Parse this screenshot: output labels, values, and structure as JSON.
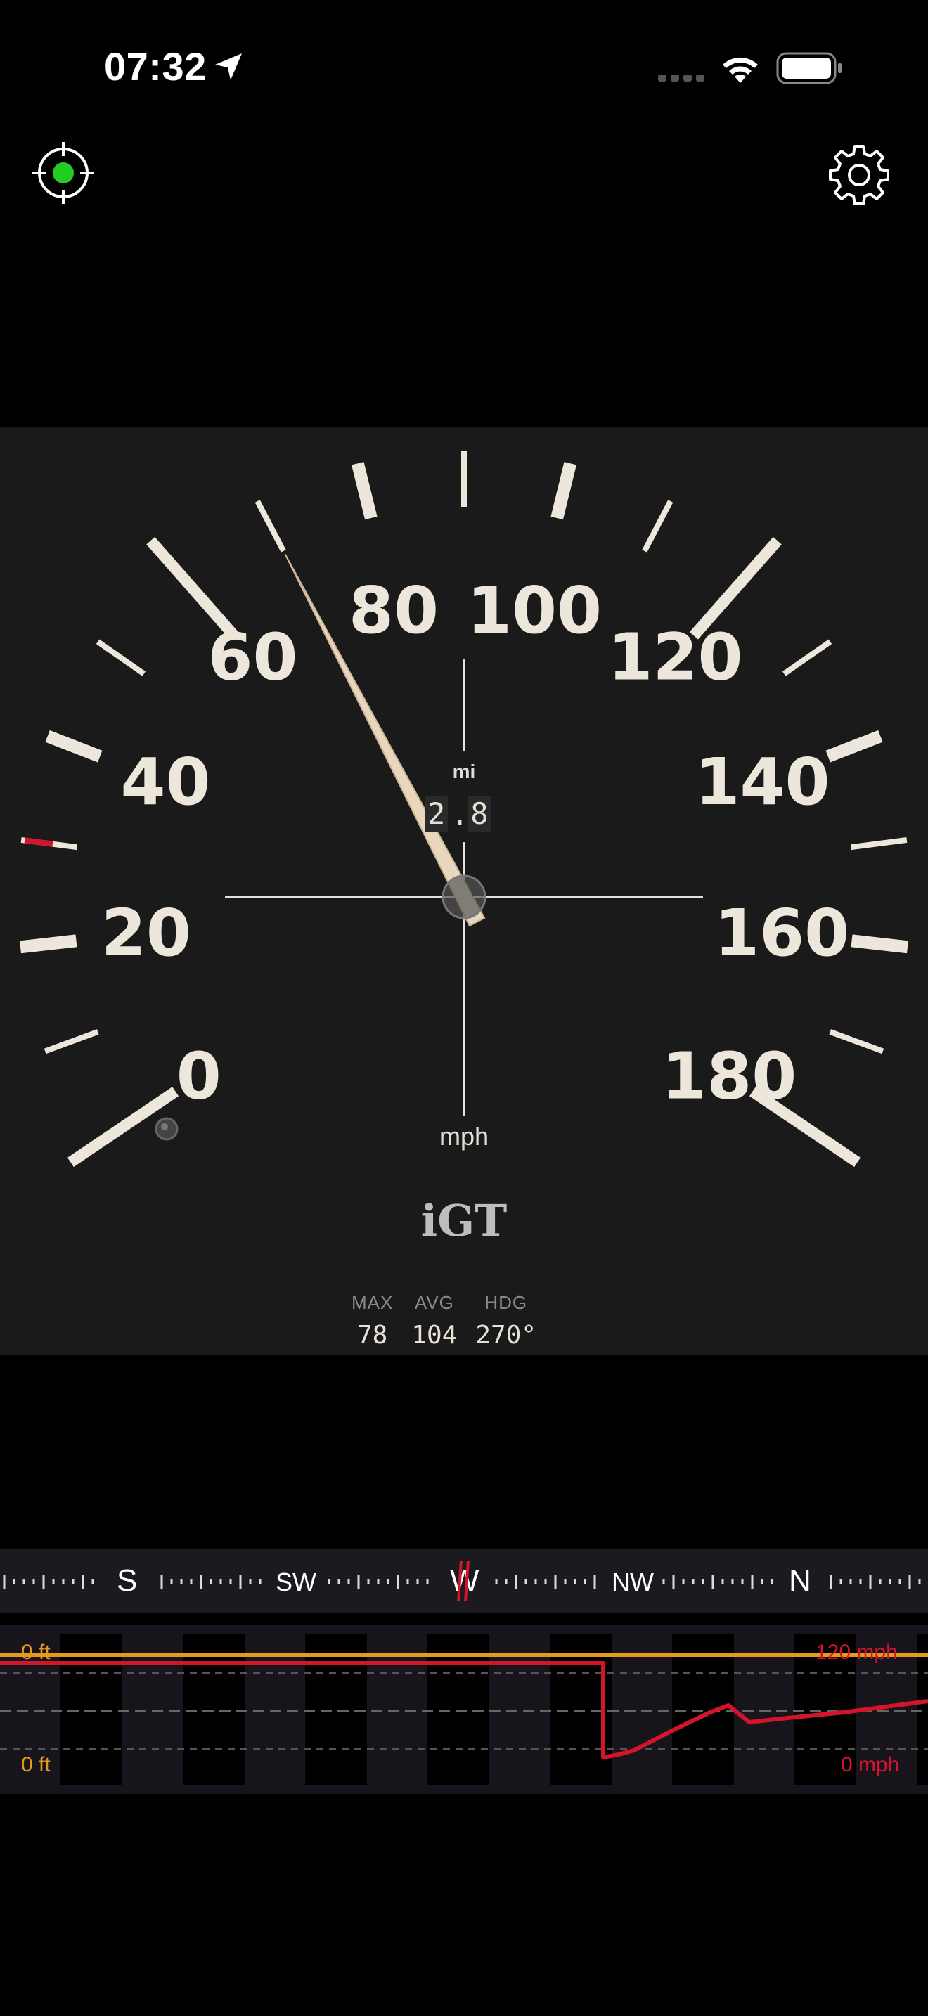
{
  "status": {
    "time": "07:32",
    "location_icon": "location-arrow-icon",
    "signal_icon": "cellular-signal-icon",
    "wifi_icon": "wifi-icon",
    "battery_icon": "battery-icon"
  },
  "toolbar": {
    "gps_icon": "gps-target-icon",
    "gps_status_color": "#22cc22",
    "settings_icon": "gear-icon"
  },
  "gauge": {
    "dial_labels": [
      "0",
      "20",
      "40",
      "60",
      "80",
      "100",
      "120",
      "140",
      "160",
      "180"
    ],
    "speed_value": 70,
    "odometer_unit": "mi",
    "odometer_digits": [
      "2",
      "8"
    ],
    "odometer_separator": ".",
    "speed_unit": "mph",
    "brand": "iGT",
    "needle_color": "#e8d6bd",
    "tick_color": "#ede6da",
    "accent_tick_color": "#d4142b"
  },
  "stats": [
    {
      "label": "MAX",
      "value": "78"
    },
    {
      "label": "AVG",
      "value": "104"
    },
    {
      "label": "HDG",
      "value": "270°"
    }
  ],
  "compass": {
    "labels": [
      "S",
      "SW",
      "W",
      "NW",
      "N"
    ],
    "heading_marker_color": "#d4142b"
  },
  "trace": {
    "altitude_top": "0 ft",
    "altitude_bottom": "0 ft",
    "speed_top": "120 mph",
    "speed_bottom": "0 mph",
    "altitude_color": "#e49a1c",
    "speed_color": "#d4142b"
  }
}
